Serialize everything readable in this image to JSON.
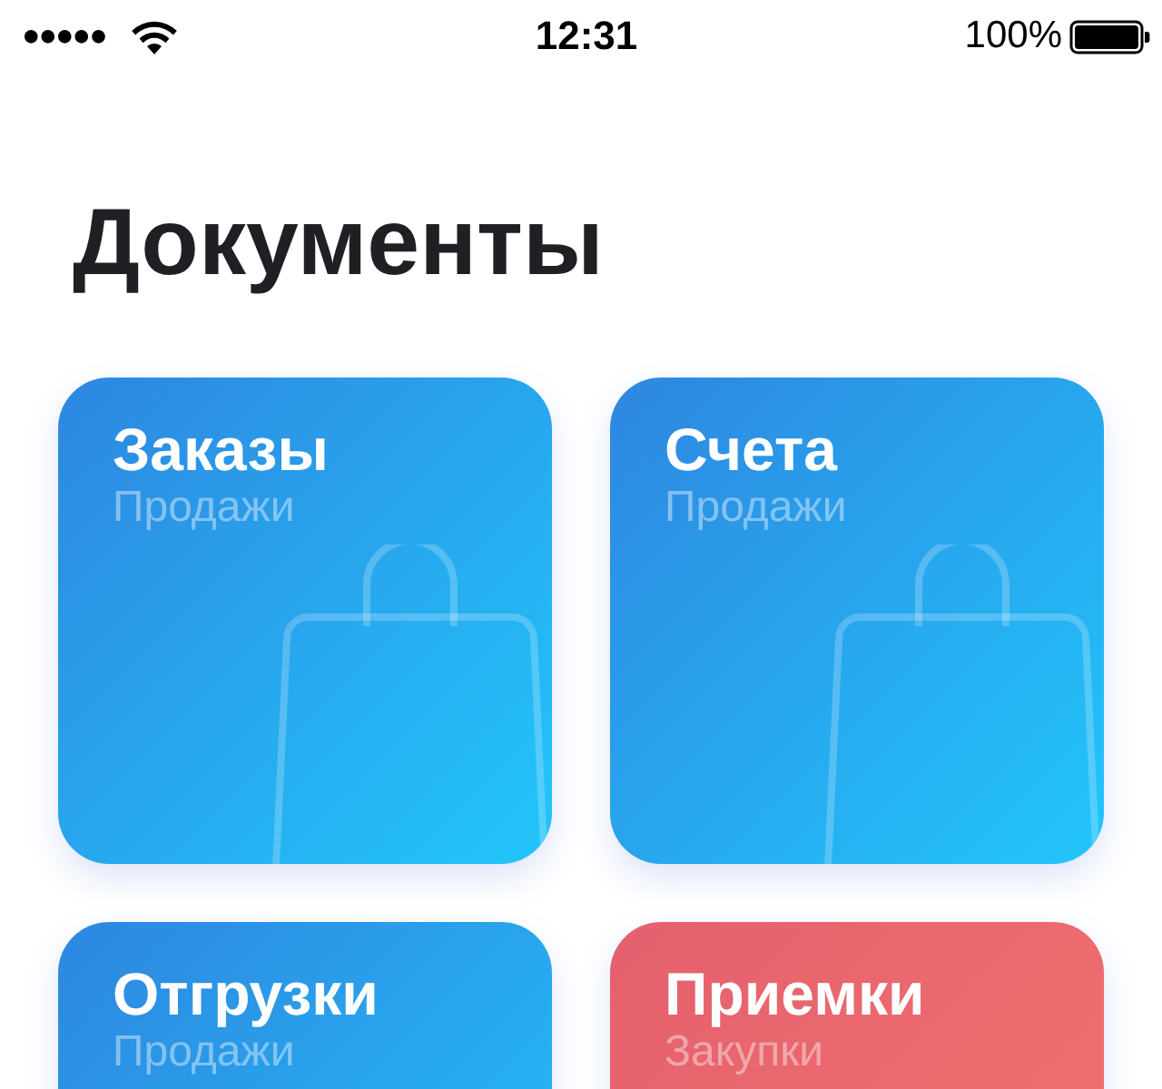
{
  "status_bar": {
    "signal_dots": "●●●●●",
    "time": "12:31",
    "battery": "100%"
  },
  "title": "Документы",
  "cards": [
    {
      "kind": "sales",
      "title": "Заказы",
      "subtitle": "Продажи",
      "color": "#2e86e0",
      "show_bag": true
    },
    {
      "kind": "sales",
      "title": "Счета",
      "subtitle": "Продажи",
      "color": "#2e86e0",
      "show_bag": true
    },
    {
      "kind": "sales",
      "title": "Отгрузки",
      "subtitle": "Продажи",
      "color": "#2e86e0",
      "show_bag": false
    },
    {
      "kind": "purchases",
      "title": "Приемки",
      "subtitle": "Закупки",
      "color": "#e4606f",
      "show_bag": false
    }
  ]
}
